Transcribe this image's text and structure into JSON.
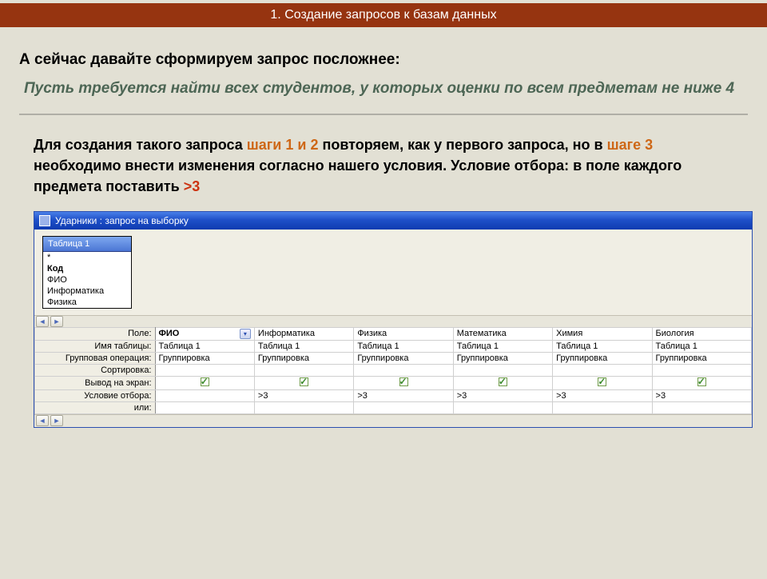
{
  "header": {
    "title": "1. Создание запросов к базам данных"
  },
  "intro": "А сейчас давайте сформируем запрос посложнее:",
  "task": "Пусть требуется найти всех студентов, у которых оценки по всем предметам не ниже 4",
  "body": {
    "t1": "Для создания такого запроса ",
    "steps12": "шаги 1 и 2",
    "t2": "  повторяем, как у первого запроса, но в ",
    "step3": "шаге 3",
    "t3": " необходимо внести изменения согласно нашего условия. Условие отбора: в поле каждого предмета поставить ",
    "gt3": ">3"
  },
  "access": {
    "title": "Ударники : запрос на выборку",
    "table_box_title": "Таблица 1",
    "fields": [
      "*",
      "Код",
      "ФИО",
      "Информатика",
      "Физика"
    ],
    "row_labels": {
      "field": "Поле:",
      "table": "Имя таблицы:",
      "group": "Групповая операция:",
      "sort": "Сортировка:",
      "show": "Вывод на экран:",
      "criteria": "Условие отбора:",
      "or": "или:"
    },
    "columns": [
      {
        "field": "ФИО",
        "table": "Таблица 1",
        "group": "Группировка",
        "criteria": "",
        "dropdown": true
      },
      {
        "field": "Информатика",
        "table": "Таблица 1",
        "group": "Группировка",
        "criteria": ">3"
      },
      {
        "field": "Физика",
        "table": "Таблица 1",
        "group": "Группировка",
        "criteria": ">3"
      },
      {
        "field": "Математика",
        "table": "Таблица 1",
        "group": "Группировка",
        "criteria": ">3"
      },
      {
        "field": "Химия",
        "table": "Таблица 1",
        "group": "Группировка",
        "criteria": ">3"
      },
      {
        "field": "Биология",
        "table": "Таблица 1",
        "group": "Группировка",
        "criteria": ">3"
      }
    ]
  }
}
